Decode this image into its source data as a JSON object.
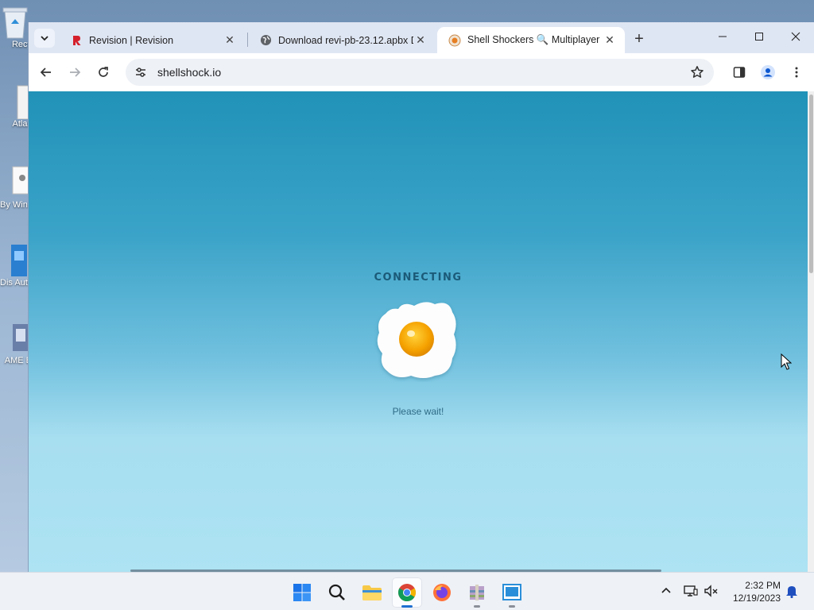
{
  "desktop": {
    "icons": [
      {
        "label": "Recy"
      },
      {
        "label": "Atlas"
      },
      {
        "label": "By Windo"
      },
      {
        "label": "Dis Auto"
      },
      {
        "label": "AME B"
      }
    ]
  },
  "browser": {
    "tabs": [
      {
        "title": "Revision | Revision",
        "favicon": "revision-logo-icon"
      },
      {
        "title": "Download revi-pb-23.12.apbx D",
        "favicon": "globe-icon"
      },
      {
        "title": "Shell Shockers 🔍 Multiplayer I",
        "favicon": "shell-shockers-egg-icon",
        "active": true
      }
    ],
    "new_tab_label": "+",
    "omnibox": {
      "url": "shellshock.io"
    }
  },
  "page": {
    "status_heading": "CONNECTING",
    "status_text": "Please wait!",
    "colors": {
      "sky_top": "#2192b8",
      "sky_bottom": "#ade3f3",
      "egg_yolk": "#f5a200",
      "heading": "#1b5a78"
    }
  },
  "taskbar": {
    "apps": [
      "start-icon",
      "search-icon",
      "file-explorer-icon",
      "chrome-icon",
      "firefox-icon",
      "winrar-icon",
      "notepad-icon"
    ],
    "clock_time": "2:32 PM",
    "clock_date": "12/19/2023"
  }
}
